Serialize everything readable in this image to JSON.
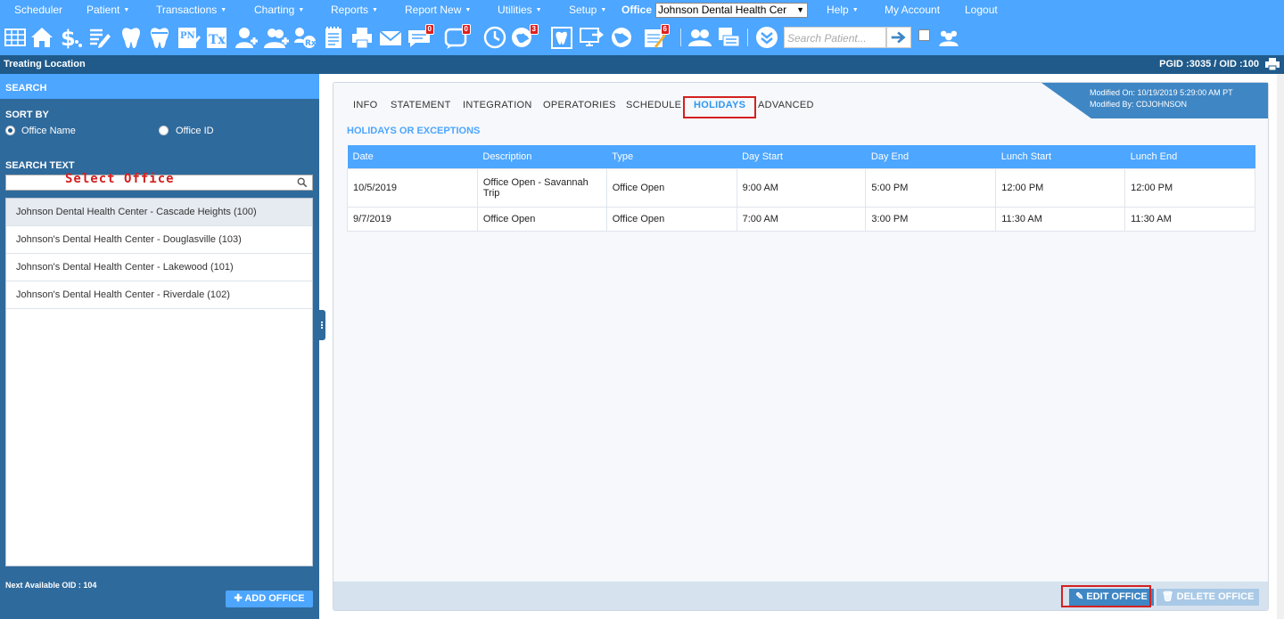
{
  "nav": {
    "items": [
      {
        "label": "Scheduler",
        "caret": false
      },
      {
        "label": "Patient",
        "caret": true
      },
      {
        "label": "Transactions",
        "caret": true
      },
      {
        "label": "Charting",
        "caret": true
      },
      {
        "label": "Reports",
        "caret": true
      },
      {
        "label": "Report New",
        "caret": true
      },
      {
        "label": "Utilities",
        "caret": true
      },
      {
        "label": "Setup",
        "caret": true
      },
      {
        "label": "Help",
        "caret": true
      },
      {
        "label": "My Account",
        "caret": false
      },
      {
        "label": "Logout",
        "caret": false
      }
    ],
    "office_label": "Office",
    "office_value": "Johnson Dental Health Cer"
  },
  "toolbar": {
    "badges": {
      "messages": "0",
      "chat": "0",
      "alerts": "3",
      "tasks": "6"
    },
    "search_placeholder": "Search Patient..."
  },
  "location_bar": {
    "title": "Treating Location",
    "ids": "PGID :3035  /  OID :100"
  },
  "sidebar": {
    "search_heading": "SEARCH",
    "sort_by_label": "SORT BY",
    "sort_options": [
      "Office Name",
      "Office ID"
    ],
    "sort_selected": "Office Name",
    "search_text_label": "SEARCH TEXT",
    "search_annotation": "Select Office",
    "offices": [
      "Johnson Dental Health Center - Cascade Heights (100)",
      "Johnson's Dental Health Center - Douglasville (103)",
      "Johnson's Dental Health Center - Lakewood (101)",
      "Johnson's Dental Health Center - Riverdale (102)"
    ],
    "next_oid": "Next Available OID : 104",
    "add_office_label": "ADD OFFICE"
  },
  "main": {
    "modified_on": "Modified On: 10/19/2019 5:29:00 AM PT",
    "modified_by": "Modified By: CDJOHNSON",
    "tabs": [
      "INFO",
      "STATEMENT",
      "INTEGRATION",
      "OPERATORIES",
      "SCHEDULE",
      "HOLIDAYS",
      "ADVANCED"
    ],
    "active_tab": "HOLIDAYS",
    "section_title": "HOLIDAYS OR EXCEPTIONS",
    "columns": [
      "Date",
      "Description",
      "Type",
      "Day Start",
      "Day End",
      "Lunch Start",
      "Lunch End"
    ],
    "rows": [
      [
        "10/5/2019",
        "Office Open - Savannah Trip",
        "Office Open",
        "9:00 AM",
        "5:00 PM",
        "12:00 PM",
        "12:00 PM"
      ],
      [
        "9/7/2019",
        "Office Open",
        "Office Open",
        "7:00 AM",
        "3:00 PM",
        "11:30 AM",
        "11:30 AM"
      ]
    ],
    "edit_label": "EDIT OFFICE",
    "delete_label": "DELETE OFFICE"
  }
}
